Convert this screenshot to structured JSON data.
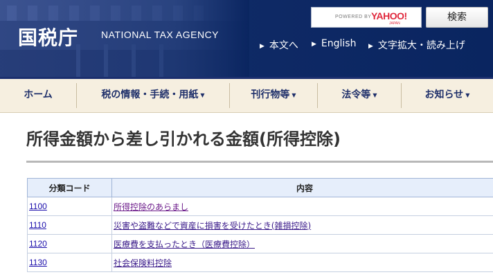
{
  "header": {
    "logo_jp": "国税庁",
    "logo_en": "NATIONAL TAX AGENCY",
    "search": {
      "powered_by": "POWERED BY",
      "brand": "YAHOO!",
      "brand_sub": "JAPAN",
      "button_label": "検索"
    },
    "utility_links": [
      {
        "label": "本文へ"
      },
      {
        "label": "English"
      },
      {
        "label": "文字拡大・読み上げ"
      }
    ]
  },
  "nav": {
    "items": [
      {
        "label": "ホーム",
        "has_dropdown": false
      },
      {
        "label": "税の情報・手続・用紙",
        "has_dropdown": true
      },
      {
        "label": "刊行物等",
        "has_dropdown": true
      },
      {
        "label": "法令等",
        "has_dropdown": true
      },
      {
        "label": "お知らせ",
        "has_dropdown": true
      }
    ]
  },
  "page": {
    "title": "所得金額から差し引かれる金額(所得控除)"
  },
  "table": {
    "headers": [
      "分類コード",
      "内容"
    ],
    "rows": [
      {
        "code": "1100",
        "content": "所得控除のあらまし"
      },
      {
        "code": "1110",
        "content": "災害や盗難などで資産に損害を受けたとき(雑損控除)"
      },
      {
        "code": "1120",
        "content": "医療費を支払ったとき（医療費控除）"
      },
      {
        "code": "1130",
        "content": "社会保険料控除"
      }
    ]
  },
  "colors": {
    "header_bg": "#0f2a66",
    "nav_bg": "#f6efe0",
    "nav_text": "#1e2f6a",
    "table_header_bg": "#e6eefb",
    "link": "#1a0dab"
  }
}
